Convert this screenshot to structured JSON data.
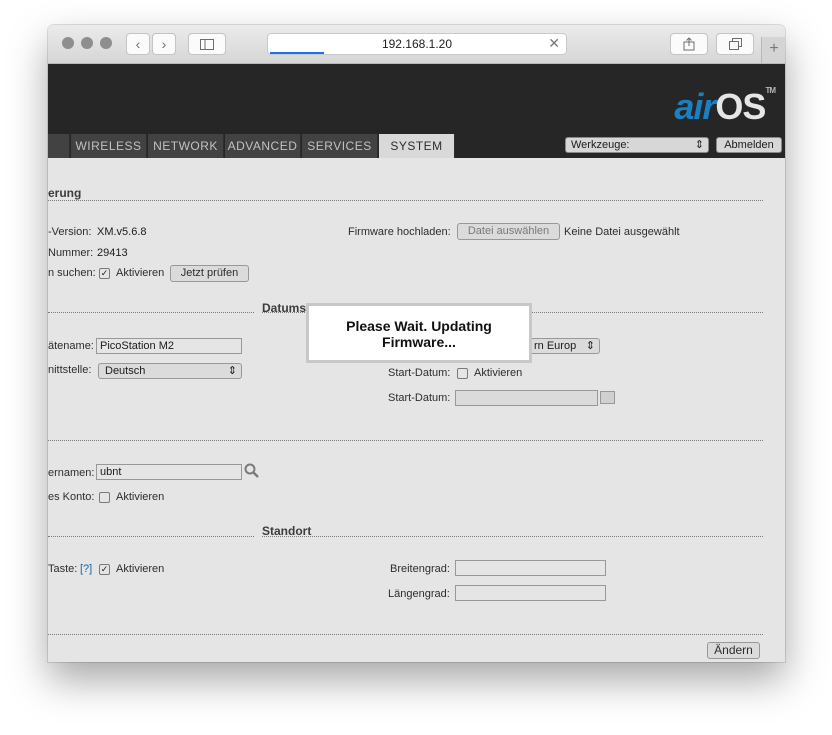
{
  "browser": {
    "url": "192.168.1.20",
    "load_progress": 0.18
  },
  "header": {
    "logo_air": "air",
    "logo_os": "OS",
    "logo_tm": "TM",
    "tabs": [
      "WIRELESS",
      "NETWORK",
      "ADVANCED",
      "SERVICES",
      "SYSTEM"
    ],
    "active_tab": "SYSTEM",
    "tools_select": "Werkzeuge:",
    "logout_label": "Abmelden"
  },
  "firmware": {
    "section_title": "erung",
    "version_label": "-Version:",
    "version_value": "XM.v5.6.8",
    "build_label": "Nummer:",
    "build_value": "29413",
    "check_label": "n suchen:",
    "check_enable": "Aktivieren",
    "check_now_button": "Jetzt prüfen",
    "upload_label": "Firmware hochladen:",
    "choose_file_button": "Datei auswählen",
    "no_file_text": "Keine Datei ausgewählt"
  },
  "device": {
    "datetime_title": "Datums",
    "name_label": "ätename:",
    "name_value": "PicoStation M2",
    "interface_label": "nittstelle:",
    "interface_value": "Deutsch",
    "timezone_value": "rn Europ",
    "start_date_label": "Start-Datum:",
    "start_date_enable": "Aktivieren",
    "start_date2_label": "Start-Datum:"
  },
  "accounts": {
    "username_label": "ernamen:",
    "username_value": "ubnt",
    "readonly_label": "es Konto:",
    "readonly_enable": "Aktivieren"
  },
  "location": {
    "section_title": "Standort",
    "reset_label": "Taste:",
    "reset_help": "[?]",
    "reset_enable": "Aktivieren",
    "latitude_label": "Breitengrad:",
    "longitude_label": "Längengrad:"
  },
  "change_button": "Ändern",
  "modal": {
    "line1": "Please Wait. Updating",
    "line2": "Firmware..."
  }
}
